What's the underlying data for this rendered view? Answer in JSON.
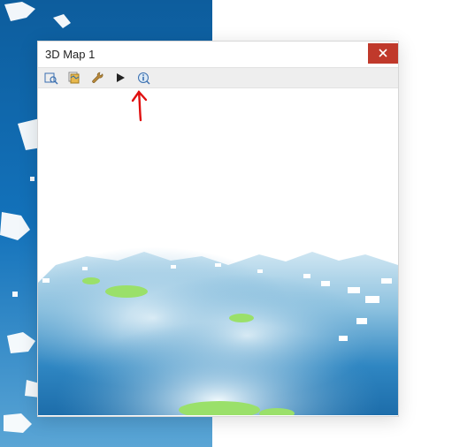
{
  "window": {
    "title": "3D Map 1"
  },
  "toolbar": {
    "items": [
      {
        "name": "zoom-extents-icon"
      },
      {
        "name": "layers-icon"
      },
      {
        "name": "settings-wrench-icon"
      },
      {
        "name": "play-icon"
      },
      {
        "name": "identify-icon"
      }
    ]
  },
  "annotation": "hand-drawn-arrow-up-to-wrench"
}
